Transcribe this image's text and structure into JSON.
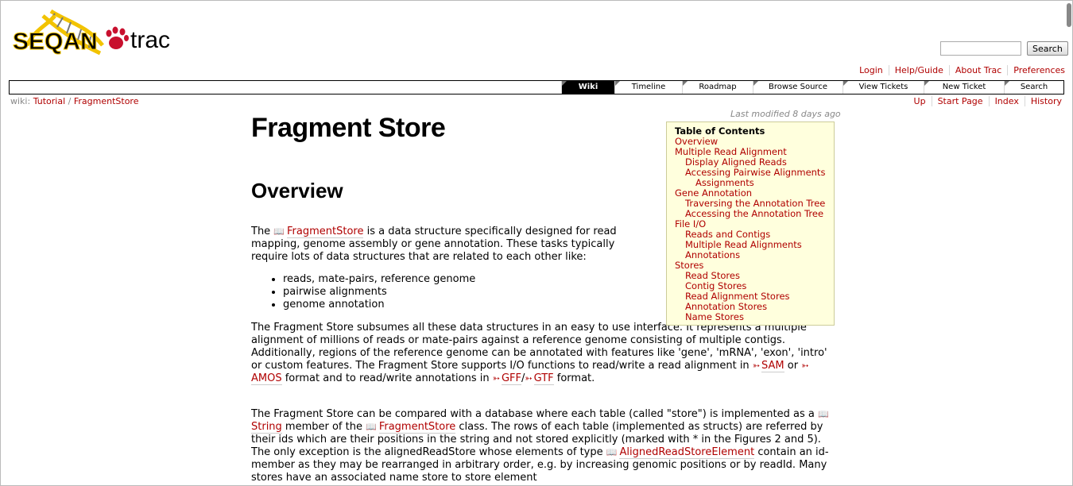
{
  "logo": {
    "text_left": "SEQAN",
    "text_right": "trac"
  },
  "search": {
    "placeholder": "",
    "button_label": "Search"
  },
  "metanav": [
    "Login",
    "Help/Guide",
    "About Trac",
    "Preferences"
  ],
  "mainnav": [
    {
      "label": "Wiki",
      "active": true
    },
    {
      "label": "Timeline",
      "active": false
    },
    {
      "label": "Roadmap",
      "active": false
    },
    {
      "label": "Browse Source",
      "active": false
    },
    {
      "label": "View Tickets",
      "active": false
    },
    {
      "label": "New Ticket",
      "active": false
    },
    {
      "label": "Search",
      "active": false
    }
  ],
  "breadcrumb": {
    "prefix": "wiki:",
    "items": [
      "Tutorial",
      "FragmentStore"
    ],
    "separator": "/"
  },
  "ctxtnav": [
    "Up",
    "Start Page",
    "Index",
    "History"
  ],
  "last_modified": "Last modified 8 days ago",
  "page": {
    "title": "Fragment Store",
    "section1": "Overview",
    "p1_a": "The ",
    "p1_link": "FragmentStore",
    "p1_b": " is a data structure specifically designed for read mapping, genome assembly or gene annotation. These tasks typically require lots of data structures that are related to each other like:",
    "bullets": [
      "reads, mate-pairs, reference genome",
      "pairwise alignments",
      "genome annotation"
    ],
    "p2_a": "The Fragment Store subsumes all these data structures in an easy to use interface. It represents a multiple alignment of millions of reads or mate-pairs against a reference genome consisting of multiple contigs. Additionally, regions of the reference genome can be annotated with features like 'gene', 'mRNA', 'exon', 'intro' or custom features. The Fragment Store supports I/O functions to read/write a read alignment in ",
    "p2_sam": "SAM",
    "p2_or": " or ",
    "p2_amos": "AMOS",
    "p2_b": " format and to read/write annotations in ",
    "p2_gff": "GFF",
    "p2_slash": "/",
    "p2_gtf": "GTF",
    "p2_c": " format.",
    "p3_a": "The Fragment Store can be compared with a database where each table (called \"store\") is implemented as a ",
    "p3_string": "String",
    "p3_b": " member of the ",
    "p3_fs": "FragmentStore",
    "p3_c": " class. The rows of each table (implemented as structs) are referred by their ids which are their positions in the string and not stored explicitly (marked with * in the Figures 2 and 5). The only exception is the alignedReadStore whose elements of type ",
    "p3_arse": "AlignedReadStoreElement",
    "p3_d": " contain an id-member as they may be rearranged in arbitrary order, e.g. by increasing genomic positions or by readId. Many stores have an associated name store to store element"
  },
  "toc": {
    "title": "Table of Contents",
    "items": [
      {
        "label": "Overview",
        "level": 1
      },
      {
        "label": "Multiple Read Alignment",
        "level": 1
      },
      {
        "label": "Display Aligned Reads",
        "level": 2
      },
      {
        "label": "Accessing Pairwise Alignments",
        "level": 2
      },
      {
        "label": "Assignments",
        "level": 3
      },
      {
        "label": "Gene Annotation",
        "level": 1
      },
      {
        "label": "Traversing the Annotation Tree",
        "level": 2
      },
      {
        "label": "Accessing the Annotation Tree",
        "level": 2
      },
      {
        "label": "File I/O",
        "level": 1
      },
      {
        "label": "Reads and Contigs",
        "level": 2
      },
      {
        "label": "Multiple Read Alignments",
        "level": 2
      },
      {
        "label": "Annotations",
        "level": 2
      },
      {
        "label": "Stores",
        "level": 1
      },
      {
        "label": "Read Stores",
        "level": 2
      },
      {
        "label": "Contig Stores",
        "level": 2
      },
      {
        "label": "Read Alignment Stores",
        "level": 2
      },
      {
        "label": "Annotation Stores",
        "level": 2
      },
      {
        "label": "Name Stores",
        "level": 2
      }
    ]
  },
  "colors": {
    "link": "#b00000",
    "toc_bg": "#ffffdd",
    "logo_yellow": "#f2c300",
    "logo_red": "#c8102e"
  }
}
